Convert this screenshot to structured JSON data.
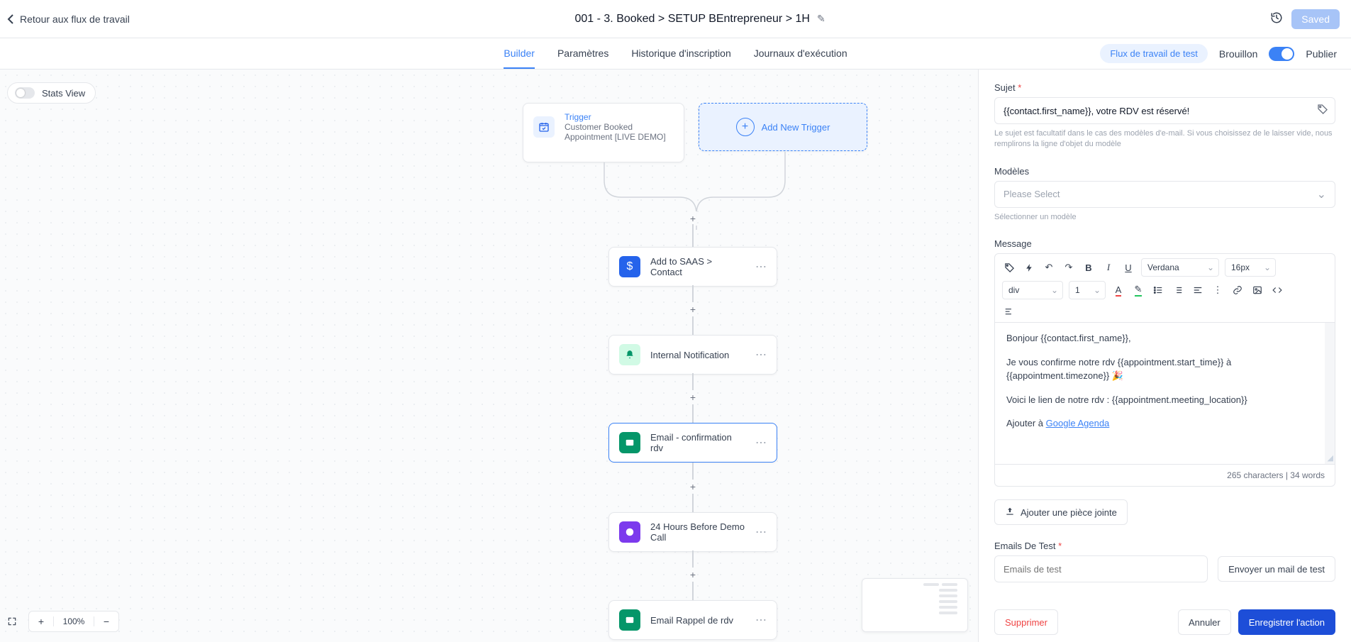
{
  "header": {
    "back": "Retour aux flux de travail",
    "title": "001 - 3. Booked > SETUP BEntrepreneur > 1H",
    "saved": "Saved"
  },
  "tabs": {
    "builder": "Builder",
    "params": "Paramètres",
    "history": "Historique d'inscription",
    "logs": "Journaux d'exécution"
  },
  "tabbar": {
    "test": "Flux de travail de test",
    "draft": "Brouillon",
    "publish": "Publier"
  },
  "canvas": {
    "stats": "Stats View",
    "trigger_label": "Trigger",
    "trigger_sub": "Customer Booked Appointment [LIVE DEMO]",
    "add_trigger": "Add New Trigger",
    "nodes": {
      "saas": "Add to SAAS > Contact",
      "internal": "Internal Notification",
      "email_confirm": "Email - confirmation rdv",
      "hours24": "24 Hours Before Demo Call",
      "email_rappel": "Email Rappel de rdv"
    },
    "zoom": "100%"
  },
  "panel": {
    "subject_label": "Sujet",
    "subject_value": "{{contact.first_name}}, votre RDV est réservé!",
    "subject_helper": "Le sujet est facultatif dans le cas des modèles d'e-mail. Si vous choisissez de le laisser vide, nous remplirons la ligne d'objet du modèle",
    "templates_label": "Modèles",
    "templates_placeholder": "Please Select",
    "templates_helper": "Sélectionner un modèle",
    "message_label": "Message",
    "font": "Verdana",
    "size": "16px",
    "tag": "div",
    "num": "1",
    "body": {
      "greeting": "Bonjour {{contact.first_name}},",
      "confirm": "Je vous confirme notre rdv {{appointment.start_time}} à {{appointment.timezone}} 🎉",
      "link_intro": "Voici le lien de notre rdv : {{appointment.meeting_location}}",
      "ajouter": "Ajouter à ",
      "agenda": "Google Agenda"
    },
    "status": "265 characters | 34 words",
    "attach": "Ajouter une pièce jointe",
    "test_label": "Emails De Test",
    "test_placeholder": "Emails de test",
    "send_test": "Envoyer un mail de test",
    "delete": "Supprimer",
    "cancel": "Annuler",
    "save": "Enregistrer l'action"
  }
}
